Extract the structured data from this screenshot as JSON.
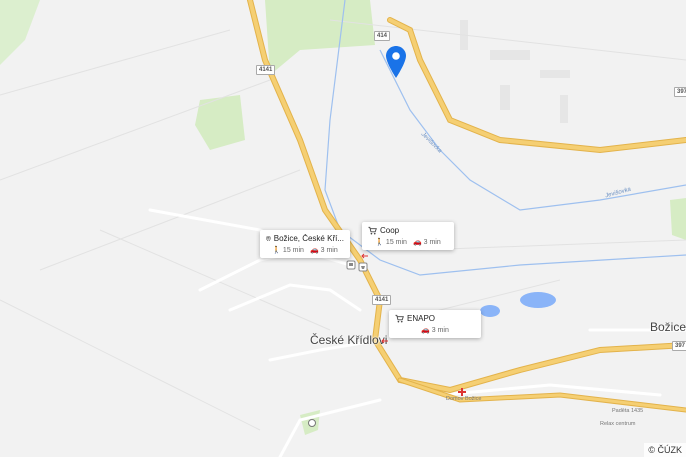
{
  "map": {
    "road_shields": [
      "414",
      "4141",
      "4141",
      "397",
      "397"
    ],
    "towns": {
      "main": "České Křídlovi",
      "east": "Božice"
    },
    "rivers": [
      "Jevišovka",
      "Jevišovka"
    ],
    "small_labels": [
      "Domov Božice",
      "Paděta 1435",
      "Relax centrum"
    ],
    "copyright": "© ČÚZK"
  },
  "poi_cards": [
    {
      "name": "Božice, České Kří...",
      "icon": "bus-icon",
      "walk": "15 min",
      "drive": "3 min"
    },
    {
      "name": "Coop",
      "icon": "cart-icon",
      "walk": "15 min",
      "drive": "3 min"
    },
    {
      "name": "ENAPO",
      "icon": "cart-icon",
      "drive": "3 min"
    }
  ],
  "colors": {
    "road_main": "#f5cf73",
    "road_edge": "#e3b34b",
    "water": "#8ab4f8",
    "green": "#d6ecc4",
    "pin": "#1a73e8"
  }
}
